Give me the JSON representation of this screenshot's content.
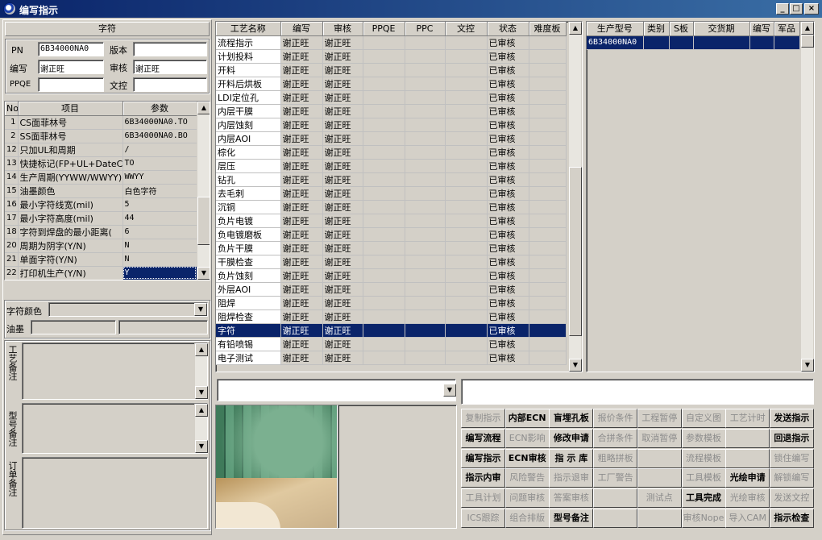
{
  "window": {
    "title": "编写指示"
  },
  "left": {
    "section_title": "字符",
    "pn_label": "PN",
    "pn_value": "6B34000NA0",
    "version_label": "版本",
    "version_value": "",
    "writer_label": "编写",
    "writer_value": "谢正旺",
    "reviewer_label": "审核",
    "reviewer_value": "谢正旺",
    "ppqe_label": "PPQE",
    "ppqe_value": "",
    "doc_label": "文控",
    "doc_value": "",
    "params_headers": [
      "No",
      "项目",
      "参数"
    ],
    "params_rows": [
      [
        "1",
        "CS面菲林号",
        "6B34000NA0.TO"
      ],
      [
        "2",
        "SS面菲林号",
        "6B34000NA0.BO"
      ],
      [
        "12",
        "只加UL和周期",
        "/"
      ],
      [
        "13",
        "快捷标记(FP+UL+DateCo",
        "TO"
      ],
      [
        "14",
        "生产周期(YYWW/WWYY)",
        "WWYY"
      ],
      [
        "15",
        "油墨颜色",
        "白色字符"
      ],
      [
        "16",
        "最小字符线宽(mil)",
        "5"
      ],
      [
        "17",
        "最小字符高度(mil)",
        "44"
      ],
      [
        "18",
        "字符到焊盘的最小距离(",
        "6"
      ],
      [
        "20",
        "周期为阴字(Y/N)",
        "N"
      ],
      [
        "21",
        "单面字符(Y/N)",
        "N"
      ],
      [
        "22",
        "打印机生产(Y/N)",
        "Y"
      ]
    ],
    "char_color_label": "字符颜色",
    "ink_label": "油墨",
    "process_note_label": "工艺备注",
    "model_note_label": "型号备注",
    "order_note_label": "订单备注"
  },
  "process": {
    "headers": [
      "工艺名称",
      "编写",
      "审核",
      "PPQE",
      "PPC",
      "文控",
      "状态",
      "难度板"
    ],
    "rows": [
      [
        "流程指示",
        "谢正旺",
        "谢正旺",
        "",
        "",
        "",
        "已审核",
        ""
      ],
      [
        "计划投料",
        "谢正旺",
        "谢正旺",
        "",
        "",
        "",
        "已审核",
        ""
      ],
      [
        "开料",
        "谢正旺",
        "谢正旺",
        "",
        "",
        "",
        "已审核",
        ""
      ],
      [
        "开料后烘板",
        "谢正旺",
        "谢正旺",
        "",
        "",
        "",
        "已审核",
        ""
      ],
      [
        "LDI定位孔",
        "谢正旺",
        "谢正旺",
        "",
        "",
        "",
        "已审核",
        ""
      ],
      [
        "内层干膜",
        "谢正旺",
        "谢正旺",
        "",
        "",
        "",
        "已审核",
        ""
      ],
      [
        "内层蚀刻",
        "谢正旺",
        "谢正旺",
        "",
        "",
        "",
        "已审核",
        ""
      ],
      [
        "内层AOI",
        "谢正旺",
        "谢正旺",
        "",
        "",
        "",
        "已审核",
        ""
      ],
      [
        "棕化",
        "谢正旺",
        "谢正旺",
        "",
        "",
        "",
        "已审核",
        ""
      ],
      [
        "层压",
        "谢正旺",
        "谢正旺",
        "",
        "",
        "",
        "已审核",
        ""
      ],
      [
        "钻孔",
        "谢正旺",
        "谢正旺",
        "",
        "",
        "",
        "已审核",
        ""
      ],
      [
        "去毛刺",
        "谢正旺",
        "谢正旺",
        "",
        "",
        "",
        "已审核",
        ""
      ],
      [
        "沉铜",
        "谢正旺",
        "谢正旺",
        "",
        "",
        "",
        "已审核",
        ""
      ],
      [
        "负片电镀",
        "谢正旺",
        "谢正旺",
        "",
        "",
        "",
        "已审核",
        ""
      ],
      [
        "负电镀磨板",
        "谢正旺",
        "谢正旺",
        "",
        "",
        "",
        "已审核",
        ""
      ],
      [
        "负片干膜",
        "谢正旺",
        "谢正旺",
        "",
        "",
        "",
        "已审核",
        ""
      ],
      [
        "干膜检查",
        "谢正旺",
        "谢正旺",
        "",
        "",
        "",
        "已审核",
        ""
      ],
      [
        "负片蚀刻",
        "谢正旺",
        "谢正旺",
        "",
        "",
        "",
        "已审核",
        ""
      ],
      [
        "外层AOI",
        "谢正旺",
        "谢正旺",
        "",
        "",
        "",
        "已审核",
        ""
      ],
      [
        "阻焊",
        "谢正旺",
        "谢正旺",
        "",
        "",
        "",
        "已审核",
        ""
      ],
      [
        "阻焊检查",
        "谢正旺",
        "谢正旺",
        "",
        "",
        "",
        "已审核",
        ""
      ],
      [
        "字符",
        "谢正旺",
        "谢正旺",
        "",
        "",
        "",
        "已审核",
        ""
      ],
      [
        "有铅喷锡",
        "谢正旺",
        "谢正旺",
        "",
        "",
        "",
        "已审核",
        ""
      ],
      [
        "电子测试",
        "谢正旺",
        "谢正旺",
        "",
        "",
        "",
        "已审核",
        ""
      ]
    ],
    "selected_index": 21
  },
  "production": {
    "headers": [
      "生产型号",
      "类别",
      "S板",
      "交货期",
      "编写",
      "军品"
    ],
    "rows": [
      [
        "6B34000NA0",
        "",
        "",
        "",
        "",
        ""
      ]
    ]
  },
  "buttons": [
    {
      "label": "复制指示",
      "enabled": false
    },
    {
      "label": "内部ECN",
      "enabled": true
    },
    {
      "label": "盲埋孔板",
      "enabled": true
    },
    {
      "label": "报价条件",
      "enabled": false
    },
    {
      "label": "工程暂停",
      "enabled": false
    },
    {
      "label": "自定义图",
      "enabled": false
    },
    {
      "label": "工艺计时",
      "enabled": false
    },
    {
      "label": "发送指示",
      "enabled": true
    },
    {
      "label": "编写流程",
      "enabled": true
    },
    {
      "label": "ECN影响",
      "enabled": false
    },
    {
      "label": "修改申请",
      "enabled": true
    },
    {
      "label": "合拼条件",
      "enabled": false
    },
    {
      "label": "取消暂停",
      "enabled": false
    },
    {
      "label": "参数模板",
      "enabled": false
    },
    {
      "label": "",
      "enabled": false
    },
    {
      "label": "回退指示",
      "enabled": true
    },
    {
      "label": "编写指示",
      "enabled": true
    },
    {
      "label": "ECN审核",
      "enabled": true
    },
    {
      "label": "指 示 库",
      "enabled": true
    },
    {
      "label": "粗略拼板",
      "enabled": false
    },
    {
      "label": "",
      "enabled": false
    },
    {
      "label": "流程模板",
      "enabled": false
    },
    {
      "label": "",
      "enabled": false
    },
    {
      "label": "锁住编写",
      "enabled": false
    },
    {
      "label": "指示内审",
      "enabled": true
    },
    {
      "label": "风险警告",
      "enabled": false
    },
    {
      "label": "指示退审",
      "enabled": false
    },
    {
      "label": "工厂警告",
      "enabled": false
    },
    {
      "label": "",
      "enabled": false
    },
    {
      "label": "工具模板",
      "enabled": false
    },
    {
      "label": "光绘申请",
      "enabled": true
    },
    {
      "label": "解锁编写",
      "enabled": false
    },
    {
      "label": "工具计划",
      "enabled": false
    },
    {
      "label": "问题审核",
      "enabled": false
    },
    {
      "label": "答案审核",
      "enabled": false
    },
    {
      "label": "",
      "enabled": false
    },
    {
      "label": "测试点",
      "enabled": false
    },
    {
      "label": "工具完成",
      "enabled": true
    },
    {
      "label": "光绘审核",
      "enabled": false
    },
    {
      "label": "发送文控",
      "enabled": false
    },
    {
      "label": "ICS跟踪",
      "enabled": false
    },
    {
      "label": "组合排版",
      "enabled": false
    },
    {
      "label": "型号备注",
      "enabled": true
    },
    {
      "label": "",
      "enabled": false
    },
    {
      "label": "",
      "enabled": false
    },
    {
      "label": "审核Nope",
      "enabled": false
    },
    {
      "label": "导入CAM",
      "enabled": false
    },
    {
      "label": "指示检查",
      "enabled": true
    }
  ]
}
